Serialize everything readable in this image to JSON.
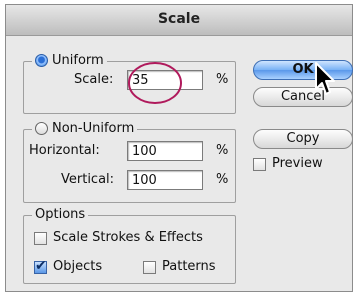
{
  "dialog": {
    "title": "Scale"
  },
  "uniform": {
    "label": "Uniform",
    "scale_label": "Scale:",
    "scale_value": "35",
    "unit": "%"
  },
  "non_uniform": {
    "label": "Non-Uniform",
    "horizontal_label": "Horizontal:",
    "horizontal_value": "100",
    "vertical_label": "Vertical:",
    "vertical_value": "100",
    "unit": "%"
  },
  "options": {
    "label": "Options",
    "scale_strokes_label": "Scale Strokes & Effects",
    "objects_label": "Objects",
    "patterns_label": "Patterns"
  },
  "buttons": {
    "ok": "OK",
    "cancel": "Cancel",
    "copy": "Copy",
    "preview": "Preview"
  }
}
